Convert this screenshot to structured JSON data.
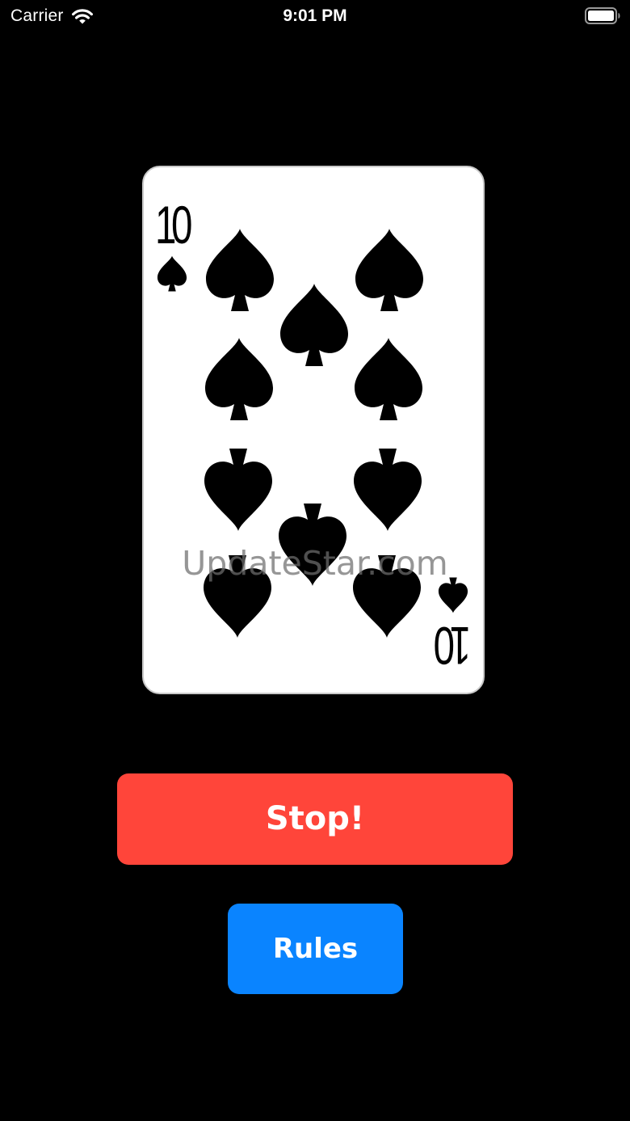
{
  "status_bar": {
    "carrier": "Carrier",
    "time": "9:01 PM",
    "wifi_icon": "wifi-icon",
    "battery_icon": "battery-full-icon"
  },
  "card": {
    "rank": "10",
    "suit": "spades",
    "suit_icon": "spade-icon",
    "pip_count": 10,
    "watermark": "UpdateStar.com"
  },
  "buttons": {
    "stop_label": "Stop!",
    "rules_label": "Rules"
  },
  "colors": {
    "background": "#000000",
    "stop_button": "#ff453a",
    "rules_button": "#0a84ff",
    "card_face": "#ffffff",
    "suit": "#000000"
  }
}
